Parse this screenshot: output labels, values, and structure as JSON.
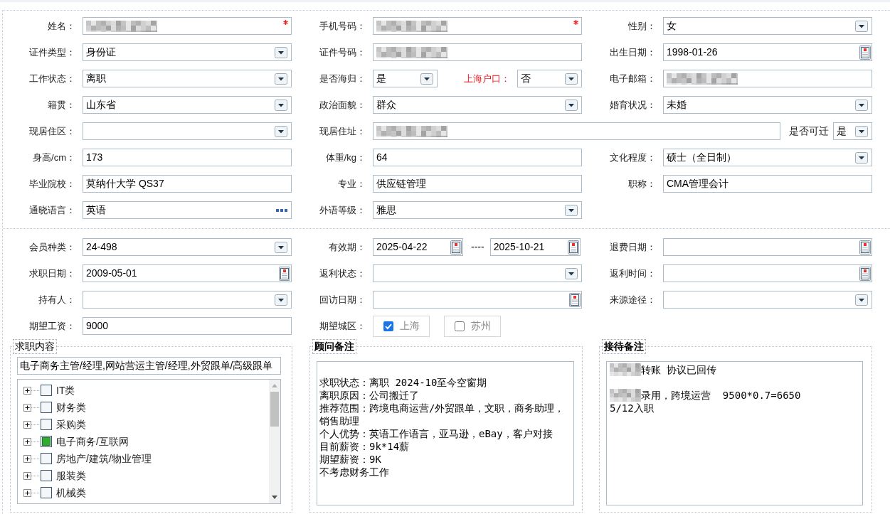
{
  "personal_section": {
    "rows": [
      [
        {
          "kind": "single",
          "fields": [
            {
              "label": "姓名：",
              "kind": "text",
              "redacted": true,
              "required": true
            }
          ]
        },
        {
          "kind": "single",
          "fields": [
            {
              "label": "手机号码：",
              "kind": "text",
              "redacted": true,
              "required": true
            }
          ]
        },
        {
          "kind": "single",
          "fields": [
            {
              "label": "性别：",
              "kind": "select",
              "value": "女"
            }
          ]
        }
      ],
      [
        {
          "kind": "single",
          "fields": [
            {
              "label": "证件类型：",
              "kind": "select",
              "value": "身份证"
            }
          ]
        },
        {
          "kind": "single",
          "fields": [
            {
              "label": "证件号码：",
              "kind": "text",
              "redacted": true
            }
          ]
        },
        {
          "kind": "single",
          "fields": [
            {
              "label": "出生日期：",
              "kind": "date",
              "value": "1998-01-26"
            }
          ]
        }
      ],
      [
        {
          "kind": "single",
          "fields": [
            {
              "label": "工作状态：",
              "kind": "select",
              "value": "离职"
            }
          ]
        },
        {
          "kind": "pair",
          "fields": [
            {
              "label": "是否海归：",
              "kind": "select",
              "value": "是",
              "highlighted": false
            },
            {
              "label": "上海户口：",
              "kind": "select",
              "value": "否",
              "highlighted": true
            }
          ]
        },
        {
          "kind": "single",
          "fields": [
            {
              "label": "电子邮箱：",
              "kind": "text",
              "redacted": true
            }
          ]
        }
      ],
      [
        {
          "kind": "single",
          "fields": [
            {
              "label": "籍贯：",
              "kind": "select",
              "value": "山东省"
            }
          ]
        },
        {
          "kind": "single",
          "fields": [
            {
              "label": "政治面貌：",
              "kind": "select",
              "value": "群众"
            }
          ]
        },
        {
          "kind": "single",
          "fields": [
            {
              "label": "婚育状况：",
              "kind": "select",
              "value": "未婚"
            }
          ]
        }
      ],
      [
        {
          "kind": "single",
          "fields": [
            {
              "label": "现居住区：",
              "kind": "select"
            }
          ]
        },
        {
          "kind": "wide",
          "fields": [
            {
              "label": "现居住址：",
              "kind": "text",
              "redacted": true
            },
            {
              "label": "是否可迁",
              "kind": "select",
              "value": "是"
            }
          ]
        }
      ],
      [
        {
          "kind": "single",
          "fields": [
            {
              "label": "身高/cm：",
              "kind": "text",
              "value": "173",
              "redacted": false
            }
          ]
        },
        {
          "kind": "single",
          "fields": [
            {
              "label": "体重/kg：",
              "kind": "text",
              "value": "64",
              "redacted": false
            }
          ]
        },
        {
          "kind": "single",
          "fields": [
            {
              "label": "文化程度：",
              "kind": "select",
              "value": "硕士（全日制）"
            }
          ]
        }
      ],
      [
        {
          "kind": "single",
          "fields": [
            {
              "label": "毕业院校：",
              "kind": "text",
              "value": "莫纳什大学 QS37",
              "redacted": false
            }
          ]
        },
        {
          "kind": "single",
          "fields": [
            {
              "label": "专业：",
              "kind": "text",
              "value": "供应链管理",
              "redacted": false
            }
          ]
        },
        {
          "kind": "single",
          "fields": [
            {
              "label": "职称：",
              "kind": "text",
              "value": "CMA管理会计",
              "redacted": false
            }
          ]
        }
      ],
      [
        {
          "kind": "single",
          "fields": [
            {
              "label": "通晓语言：",
              "kind": "picker",
              "value": "英语"
            }
          ]
        },
        {
          "kind": "single",
          "fields": [
            {
              "label": "外语等级：",
              "kind": "select",
              "value": "雅思"
            }
          ]
        }
      ]
    ]
  },
  "member_section": {
    "rows": [
      [
        {
          "kind": "single",
          "fields": [
            {
              "label": "会员种类：",
              "kind": "select",
              "value": "24-498"
            }
          ]
        },
        {
          "kind": "range",
          "separator": "----",
          "fields": [
            {
              "label": "有效期：",
              "kind": "date",
              "value": "2025-04-22"
            },
            {
              "kind": "date",
              "value": "2025-10-21"
            }
          ]
        },
        {
          "kind": "single",
          "fields": [
            {
              "label": "退费日期：",
              "kind": "date"
            }
          ]
        }
      ],
      [
        {
          "kind": "single",
          "fields": [
            {
              "label": "求职日期：",
              "kind": "date",
              "value": "2009-05-01"
            }
          ]
        },
        {
          "kind": "single",
          "fields": [
            {
              "label": "返利状态：",
              "kind": "select"
            }
          ]
        },
        {
          "kind": "single",
          "fields": [
            {
              "label": "返利时间：",
              "kind": "date"
            }
          ]
        }
      ],
      [
        {
          "kind": "single",
          "fields": [
            {
              "label": "持有人：",
              "kind": "select"
            }
          ]
        },
        {
          "kind": "single",
          "fields": [
            {
              "label": "回访日期：",
              "kind": "date"
            }
          ]
        },
        {
          "kind": "single",
          "fields": [
            {
              "label": "来源途径：",
              "kind": "select"
            }
          ]
        }
      ],
      [
        {
          "kind": "single",
          "fields": [
            {
              "label": "期望工资：",
              "kind": "text",
              "value": "9000",
              "redacted": false
            }
          ]
        },
        {
          "kind": "single",
          "fields": [
            {
              "label": "期望城区：",
              "kind": "checkgroup",
              "options": [
                {
                  "label": "上海",
                  "checked": true
                },
                {
                  "label": "苏州",
                  "checked": false
                }
              ]
            }
          ]
        }
      ]
    ]
  },
  "job_content": {
    "legend": "求职内容",
    "summary": "电子商务主管/经理,网站营运主管/经理,外贸跟单/高级跟单",
    "categories": [
      {
        "label": "IT类",
        "checked": false,
        "expanded": false
      },
      {
        "label": "财务类",
        "checked": false,
        "expanded": false
      },
      {
        "label": "采购类",
        "checked": false,
        "expanded": false
      },
      {
        "label": "电子商务/互联网",
        "checked": true,
        "expanded": false
      },
      {
        "label": "房地产/建筑/物业管理",
        "checked": false,
        "expanded": false
      },
      {
        "label": "服装类",
        "checked": false,
        "expanded": false
      },
      {
        "label": "机械类",
        "checked": false,
        "expanded": false
      }
    ]
  },
  "advisor_notes": {
    "legend": "顾问备注",
    "lines": [
      "求职状态：离职 2024-10至今空窗期",
      "离职原因：公司搬迁了",
      "推荐范围：跨境电商运营/外贸跟单，文职，商务助理，销售助理",
      "个人优势：英语工作语言，亚马逊，eBay，客户对接",
      "目前薪资：9k*14薪",
      "期望薪资：9K",
      "不考虑财务工作"
    ]
  },
  "reception_notes": {
    "legend": "接待备注",
    "paragraphs": [
      {
        "lines": [
          {
            "redacted": true,
            "text": "转账 协议已回传"
          }
        ]
      },
      {
        "lines": [
          {
            "redacted": true,
            "text": "录用，跨境运营  9500*0.7=6650"
          },
          {
            "redacted": false,
            "text": "5/12入职"
          }
        ]
      }
    ]
  }
}
